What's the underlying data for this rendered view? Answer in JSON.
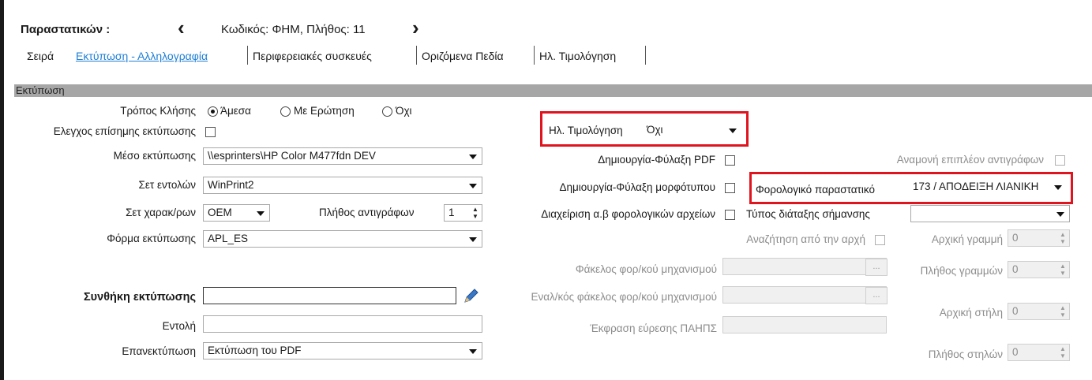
{
  "header": {
    "title": "Παραστατικών :",
    "prev_icon": "‹",
    "record": "Κωδικός: ΦΗΜ, Πλήθος: 11",
    "next_icon": "›"
  },
  "tabs": [
    {
      "label": "Σειρά"
    },
    {
      "label": "Εκτύπωση - Αλληλογραφία"
    },
    {
      "label": "Περιφερειακές συσκευές"
    },
    {
      "label": "Οριζόμενα Πεδία"
    },
    {
      "label": "Ηλ. Τιμολόγηση"
    }
  ],
  "section": {
    "title": "Εκτύπωση"
  },
  "left": {
    "call_mode_label": "Τρόπος Κλήσης",
    "radio_direct": "Άμεσα",
    "radio_ask": "Με Ερώτηση",
    "radio_no": "Όχι",
    "official_check_label": "Ελεγχος επίσημης εκτύπωσης",
    "medium_label": "Μέσο εκτύπωσης",
    "medium_value": "\\\\esprinters\\HP Color M477fdn DEV",
    "commands_label": "Σετ εντολών",
    "commands_value": "WinPrint2",
    "charset_label": "Σετ χαρακ/ρων",
    "charset_value": "OEM",
    "copies_label": "Πλήθος αντιγράφων",
    "copies_value": "1",
    "form_label": "Φόρμα εκτύπωσης",
    "form_value": "APL_ES",
    "condition_label": "Συνθήκη εκτύπωσης",
    "condition_value": "",
    "command_label": "Εντολή",
    "command_value": "",
    "reprint_label": "Επανεκτύπωση",
    "reprint_value": "Εκτύπωση του PDF"
  },
  "middle": {
    "einvoice_label": "Ηλ. Τιμολόγηση",
    "einvoice_value": "Όχι",
    "pdf_label": "Δημιουργία-Φύλαξη PDF",
    "template_label": "Δημιουργία-Φύλαξη μορφότυπου",
    "taxfiles_label": "Διαχείριση α.β φορολογικών αρχείων",
    "search_start_label": "Αναζήτηση από την αρχή",
    "folder_label": "Φάκελος φορ/κού μηχανισμού",
    "alt_folder_label": "Εναλ/κός φάκελος φορ/κού μηχανισμού",
    "expr_label": "Έκφραση εύρεσης ΠΑΗΠΣ"
  },
  "right": {
    "wait_copies_label": "Αναμονή επιπλέον αντιγράφων",
    "tax_doc_label": "Φορολογικό παραστατικό",
    "tax_doc_value": "173 / ΑΠΟΔΕΙΞΗ ΛΙΑΝΙΚΗ",
    "marking_label": "Τύπος διάταξης σήμανσης",
    "marking_value": "",
    "start_line_label": "Αρχική γραμμή",
    "start_line_value": "0",
    "lines_label": "Πλήθος γραμμών",
    "lines_value": "0",
    "start_col_label": "Αρχική στήλη",
    "start_col_value": "0",
    "cols_label": "Πλήθος στηλών",
    "cols_value": "0"
  }
}
